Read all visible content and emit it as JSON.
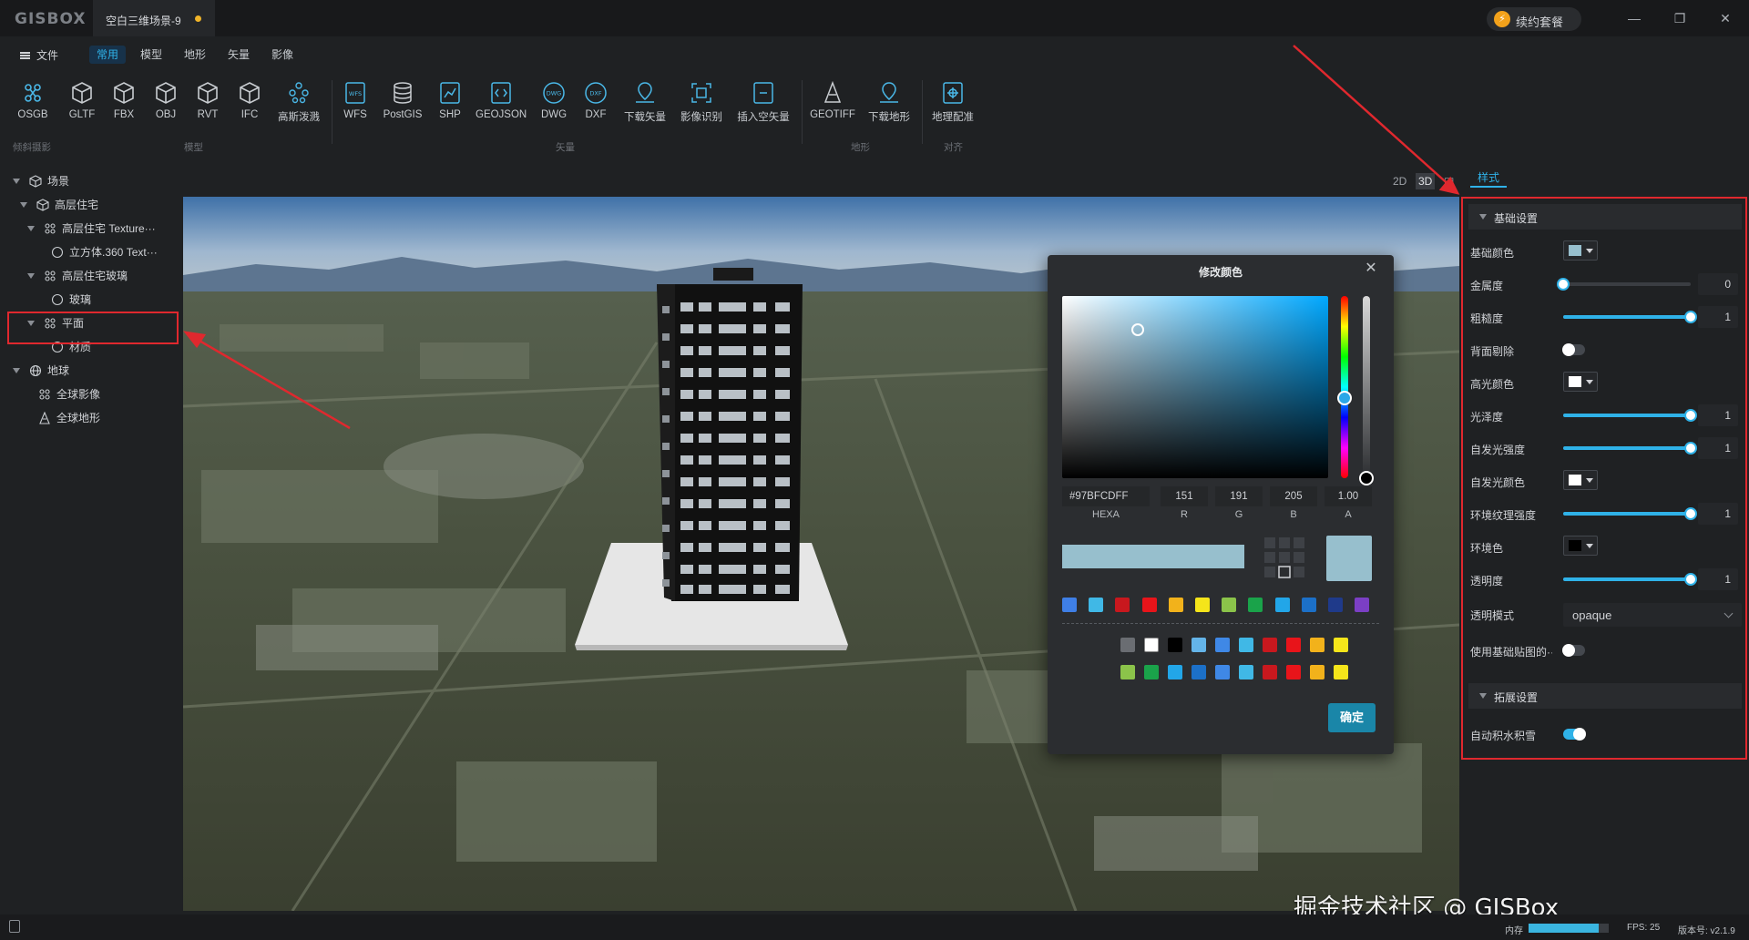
{
  "app": {
    "logo": "GISBOX",
    "doc_tab": "空白三维场景-9",
    "renew": "续约套餐"
  },
  "window_controls": [
    "—",
    "❐",
    "✕"
  ],
  "menu": {
    "file": "文件",
    "tabs": [
      "常用",
      "模型",
      "地形",
      "矢量",
      "影像"
    ],
    "active_tab": 0
  },
  "ribbon": {
    "buttons": [
      {
        "label": "OSGB",
        "icon": "osgb-icon"
      },
      {
        "label": "GLTF",
        "icon": "cube-icon"
      },
      {
        "label": "FBX",
        "icon": "cube-icon"
      },
      {
        "label": "OBJ",
        "icon": "cube-icon"
      },
      {
        "label": "RVT",
        "icon": "cube-icon"
      },
      {
        "label": "IFC",
        "icon": "cube-icon"
      },
      {
        "label": "高斯泼溅",
        "icon": "gaussian-splat-icon"
      },
      {
        "label": "WFS",
        "icon": "wfs-icon"
      },
      {
        "label": "PostGIS",
        "icon": "database-icon"
      },
      {
        "label": "SHP",
        "icon": "shp-icon"
      },
      {
        "label": "GEOJSON",
        "icon": "geojson-icon"
      },
      {
        "label": "DWG",
        "icon": "dwg-icon"
      },
      {
        "label": "DXF",
        "icon": "dxf-icon"
      },
      {
        "label": "下载矢量",
        "icon": "download-vector-icon"
      },
      {
        "label": "影像识别",
        "icon": "image-recognition-icon"
      },
      {
        "label": "插入空矢量",
        "icon": "insert-vector-icon"
      },
      {
        "label": "GEOTIFF",
        "icon": "geotiff-icon"
      },
      {
        "label": "下载地形",
        "icon": "download-terrain-icon"
      },
      {
        "label": "地理配准",
        "icon": "georeference-icon"
      }
    ],
    "groups": [
      "倾斜摄影",
      "模型",
      "矢量",
      "地形",
      "对齐"
    ]
  },
  "tree": {
    "nodes": [
      {
        "label": "场景",
        "icon": "scene-icon"
      },
      {
        "label": "高层住宅",
        "icon": "cube-icon"
      },
      {
        "label": "高层住宅  Texture···",
        "icon": "mesh-icon"
      },
      {
        "label": "立方体.360  Text···",
        "icon": "circle-icon"
      },
      {
        "label": "高层住宅玻璃",
        "icon": "mesh-icon"
      },
      {
        "label": "玻璃",
        "icon": "circle-icon"
      },
      {
        "label": "平面",
        "icon": "mesh-icon"
      },
      {
        "label": "材质",
        "icon": "circle-icon"
      },
      {
        "label": "地球",
        "icon": "globe-icon"
      },
      {
        "label": "全球影像",
        "icon": "imagery-icon"
      },
      {
        "label": "全球地形",
        "icon": "terrain-icon"
      }
    ]
  },
  "view_toggles": [
    "2D",
    "3D",
    "◫"
  ],
  "color_picker": {
    "title": "修改颜色",
    "hexa": "#97BFCDFF",
    "hexa_label": "HEXA",
    "channels": [
      {
        "value": "151",
        "label": "R"
      },
      {
        "value": "191",
        "label": "G"
      },
      {
        "value": "205",
        "label": "B"
      },
      {
        "value": "1.00",
        "label": "A"
      }
    ],
    "current_color": "#97bfcd",
    "ok": "确定",
    "swatches_row1": [
      "#3f7fe6",
      "#40b8e6",
      "#c8181e",
      "#e8141a",
      "#f2b21b",
      "#f5e51a",
      "#8bc34a",
      "#1aa34a",
      "#22a6e8",
      "#1c70c8",
      "#1f3a8a",
      "#7b3fc4"
    ],
    "swatches_row2": [
      "#6a6d72",
      "#ffffff",
      "#000000",
      "#64b4e8",
      "#3f88e6",
      "#40b8e6",
      "#c8181e",
      "#e8141a",
      "#f2b21b",
      "#f5e51a"
    ],
    "swatches_row3": [
      "#8bc34a",
      "#1aa34a",
      "#22a6e8",
      "#1c70c8",
      "#3f88e6",
      "#40b8e6",
      "#c8181e",
      "#e8141a",
      "#f2b21b",
      "#f5e51a"
    ]
  },
  "right_panel": {
    "tab": "样式",
    "basic_section": "基础设置",
    "ext_section": "拓展设置",
    "rows": [
      {
        "label": "基础颜色",
        "type": "color",
        "color": "#97bfcd"
      },
      {
        "label": "金属度",
        "type": "slider",
        "value": "0",
        "fraction": 0
      },
      {
        "label": "粗糙度",
        "type": "slider",
        "value": "1",
        "fraction": 1
      },
      {
        "label": "背面剔除",
        "type": "toggle",
        "on": false
      },
      {
        "label": "高光颜色",
        "type": "color",
        "color": "#ffffff"
      },
      {
        "label": "光泽度",
        "type": "slider",
        "value": "1",
        "fraction": 1
      },
      {
        "label": "自发光强度",
        "type": "slider",
        "value": "1",
        "fraction": 1
      },
      {
        "label": "自发光颜色",
        "type": "color",
        "color": "#ffffff"
      },
      {
        "label": "环境纹理强度",
        "type": "slider",
        "value": "1",
        "fraction": 1
      },
      {
        "label": "环境色",
        "type": "color",
        "color": "#000000"
      },
      {
        "label": "透明度",
        "type": "slider",
        "value": "1",
        "fraction": 1
      },
      {
        "label": "透明模式",
        "type": "select",
        "value": "opaque"
      },
      {
        "label": "使用基础贴图的···",
        "type": "toggle",
        "on": false
      }
    ],
    "ext_rows": [
      {
        "label": "自动积水积雪",
        "type": "toggle",
        "on": true
      }
    ]
  },
  "watermark": "掘金技术社区 @ GISBox",
  "status": {
    "mem_label": "内存",
    "mem_fraction": 0.88,
    "fps": "FPS: 25",
    "version": "版本号: v2.1.9"
  },
  "accent": "#2fb2e8"
}
